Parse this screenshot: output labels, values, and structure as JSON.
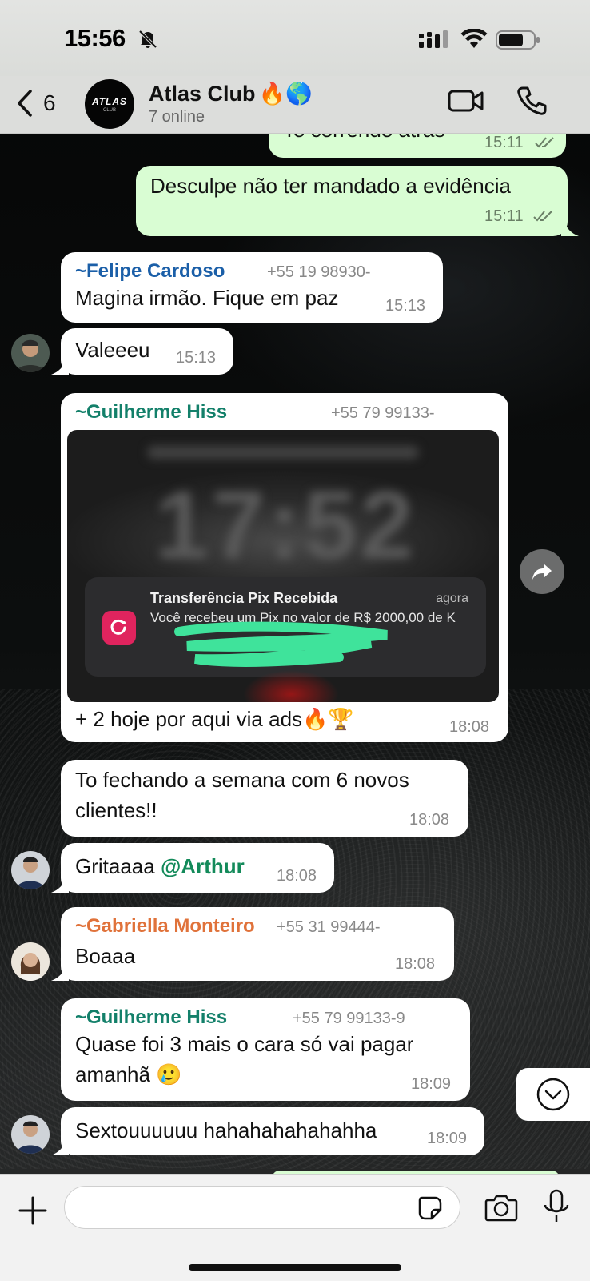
{
  "status": {
    "time": "15:56"
  },
  "header": {
    "back_count": "6",
    "group_name": "Atlas Club",
    "group_emoji": "🔥🌎",
    "subtitle": "7 online",
    "avatar_logo": "ATLAS",
    "avatar_logo_sub": "CLUB"
  },
  "messages": [
    {
      "id": "m1",
      "direction": "out",
      "text": "To correndo atras",
      "time": "15:11"
    },
    {
      "id": "m2",
      "direction": "out",
      "text": "Desculpe não ter mandado a evidência",
      "time": "15:11"
    },
    {
      "id": "m3",
      "direction": "in",
      "sender": "~Felipe Cardoso",
      "phone": "+55 19 98930-",
      "text": "Magina irmão. Fique em paz",
      "time": "15:13"
    },
    {
      "id": "m4",
      "direction": "in",
      "text": "Valeeeu",
      "time": "15:13"
    },
    {
      "id": "m5",
      "direction": "in",
      "sender": "~Guilherme Hiss",
      "phone": "+55 79 99133-",
      "text": "+ 2 hoje por aqui via ads🔥🏆",
      "time": "18:08",
      "image": {
        "blurred_time": "17:52",
        "notif_title": "Transferência Pix Recebida",
        "notif_when": "agora",
        "notif_body": "Você recebeu um Pix no valor de R$ 2000,00 de K"
      }
    },
    {
      "id": "m6",
      "direction": "in",
      "text_line1": "To fechando a semana com 6 novos",
      "text_line2": "clientes!!",
      "time": "18:08"
    },
    {
      "id": "m7",
      "direction": "in",
      "text": "Gritaaaa ",
      "mention": "@Arthur",
      "time": "18:08"
    },
    {
      "id": "m8",
      "direction": "in",
      "sender": "~Gabriella Monteiro",
      "phone": "+55 31 99444-",
      "text": "Boaaa",
      "time": "18:08"
    },
    {
      "id": "m9",
      "direction": "in",
      "sender": "~Guilherme Hiss",
      "phone": "+55 79 99133-9",
      "text_line1": "Quase foi 3 mais o cara só vai pagar",
      "text_line2": "amanhã 🥲",
      "time": "18:09"
    },
    {
      "id": "m10",
      "direction": "in",
      "text": "Sextouuuuuu hahahahahahahha",
      "time": "18:09"
    }
  ],
  "colors": {
    "felipe": "#1b5fa8",
    "guilherme": "#13806a",
    "gabriella": "#e0723a",
    "out_bubble": "#d9fdd3",
    "in_bubble": "#ffffff",
    "mention": "#138a5a"
  },
  "input": {
    "placeholder": ""
  }
}
